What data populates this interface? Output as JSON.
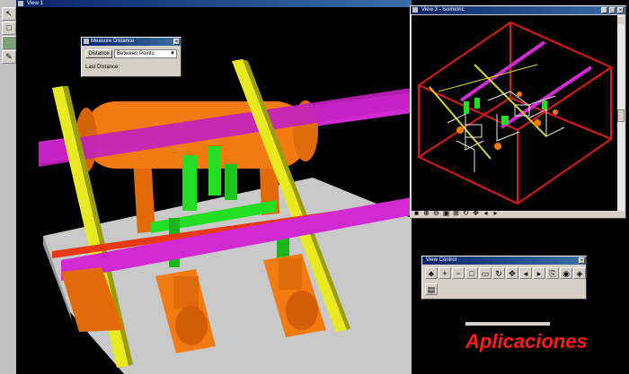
{
  "view1": {
    "title": "View 1"
  },
  "view3": {
    "title": "View 3 - Isometric"
  },
  "measure": {
    "title": "Measure Distance",
    "distance_label": "Distance",
    "mode_value": "Between Points",
    "last_distance_label": "Last Distance:"
  },
  "viewcontrol": {
    "title": "View Control"
  },
  "brand": {
    "text": "Aplicaciones"
  },
  "colors": {
    "background": "#000000",
    "pipe_magenta": "#d22ad2",
    "vessel_orange": "#f27a10",
    "steel_yellow": "#f0f020",
    "pump_green": "#22dd22",
    "box_red": "#e01818",
    "brand_red": "#ff1a1a"
  },
  "icons": [
    "select-arrow-icon",
    "fence-icon",
    "view-icon",
    "measure-icon",
    "zoom-in-icon",
    "zoom-out-icon",
    "fit-view-icon",
    "rotate-icon",
    "pan-icon"
  ]
}
